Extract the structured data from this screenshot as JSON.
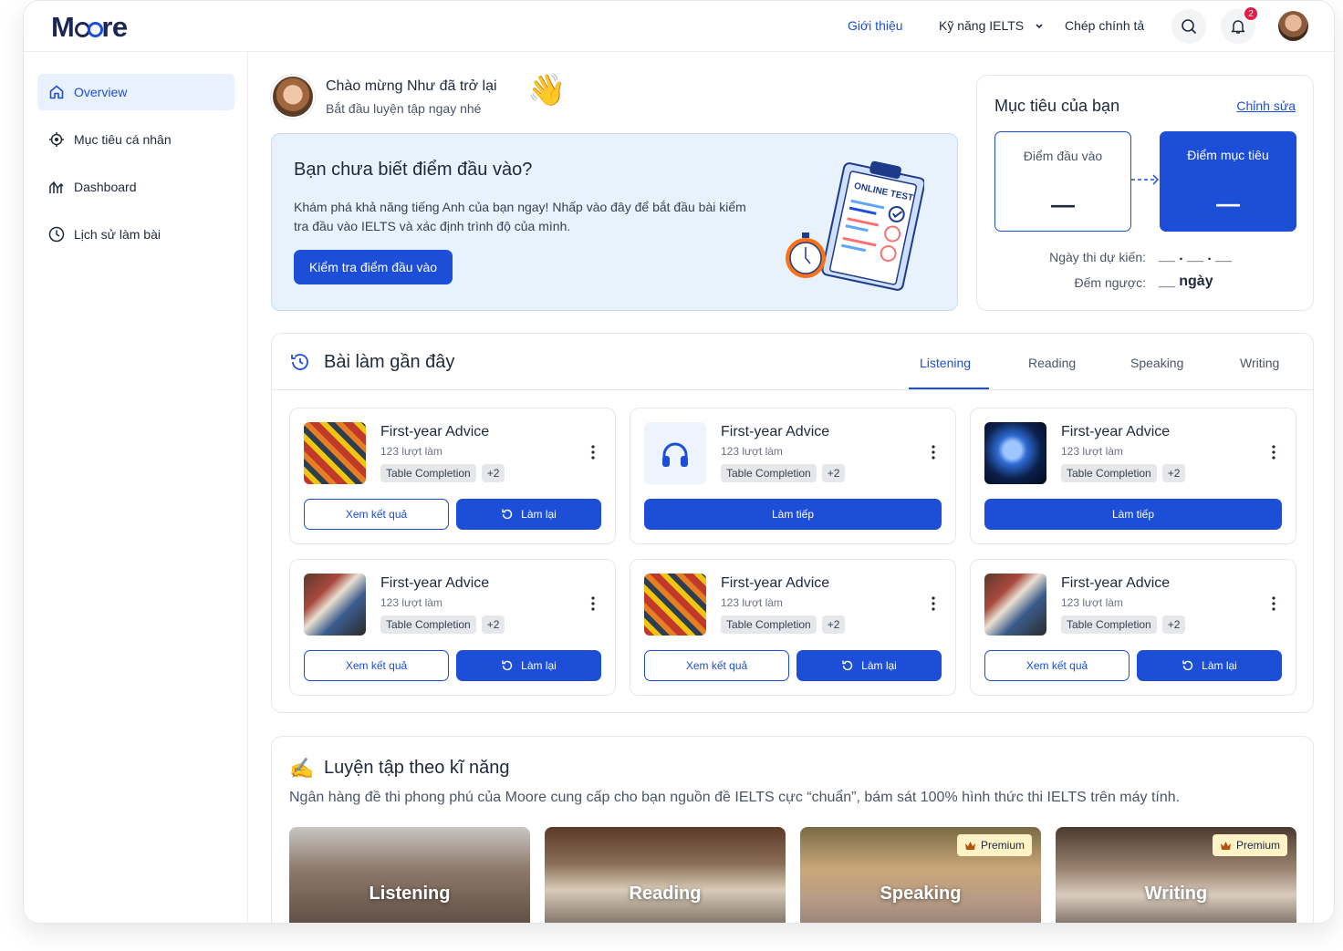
{
  "topbar": {
    "logo": "Moore",
    "nav": [
      "Giới thiệu",
      "Kỹ năng IELTS",
      "Chép chính tả"
    ],
    "notification_count": "2"
  },
  "sidebar": {
    "items": [
      {
        "label": "Overview",
        "icon": "home-icon",
        "active": true
      },
      {
        "label": "Mục tiêu cá nhân",
        "icon": "target-icon"
      },
      {
        "label": "Dashboard",
        "icon": "chart-icon"
      },
      {
        "label": "Lịch sử làm bài",
        "icon": "clock-icon"
      }
    ]
  },
  "welcome": {
    "title": "Chào mừng Như đã trở lại",
    "subtitle": "Bắt đầu luyện tập ngay nhé",
    "emoji": "👋"
  },
  "entry_test": {
    "title": "Bạn chưa biết điểm đầu vào?",
    "body": "Khám phá khả năng tiếng Anh của bạn ngay! Nhấp vào đây để bắt đầu bài kiểm tra đầu vào IELTS và xác định trình độ của mình.",
    "button": "Kiểm tra điểm đầu vào",
    "illustration_label": "ONLINE TEST"
  },
  "goal": {
    "title": "Mục tiêu của bạn",
    "edit": "Chỉnh sửa",
    "entry_label": "Điểm đầu vào",
    "entry_value": "—",
    "target_label": "Điểm mục tiêu",
    "target_value": "—",
    "exam_date_label": "Ngày thi dự kiến:",
    "exam_date_value": "__ . __ . __",
    "countdown_label": "Đếm ngược:",
    "countdown_value": "__ ngày"
  },
  "recent": {
    "title": "Bài làm gần đây",
    "tabs": [
      "Listening",
      "Reading",
      "Speaking",
      "Writing"
    ],
    "active_tab": "Listening",
    "cards": [
      {
        "title": "First-year Advice",
        "count": "123 lượt làm",
        "tag": "Table Completion",
        "more": "+2",
        "thumb": "comics",
        "btn1": "Xem kết quả",
        "btn2": "Làm lại"
      },
      {
        "title": "First-year Advice",
        "count": "123 lượt làm",
        "tag": "Table Completion",
        "more": "+2",
        "thumb": "headphones",
        "btn": "Làm tiếp"
      },
      {
        "title": "First-year Advice",
        "count": "123 lượt làm",
        "tag": "Table Completion",
        "more": "+2",
        "thumb": "globe",
        "btn": "Làm tiếp"
      },
      {
        "title": "First-year Advice",
        "count": "123 lượt làm",
        "tag": "Table Completion",
        "more": "+2",
        "thumb": "students",
        "btn1": "Xem kết quả",
        "btn2": "Làm lại"
      },
      {
        "title": "First-year Advice",
        "count": "123 lượt làm",
        "tag": "Table Completion",
        "more": "+2",
        "thumb": "comics",
        "btn1": "Xem kết quả",
        "btn2": "Làm lại"
      },
      {
        "title": "First-year Advice",
        "count": "123 lượt làm",
        "tag": "Table Completion",
        "more": "+2",
        "thumb": "students",
        "btn1": "Xem kết quả",
        "btn2": "Làm lại"
      }
    ]
  },
  "practice": {
    "title": "Luyện tập theo kĩ năng",
    "emoji": "✍️",
    "description": "Ngân hàng đề thi phong phú của Moore cung cấp cho bạn nguồn đề IELTS cực “chuẩn”, bám sát 100% hình thức thi IELTS trên máy tính.",
    "skills": [
      {
        "name": "Listening",
        "premium": ""
      },
      {
        "name": "Reading",
        "premium": ""
      },
      {
        "name": "Speaking",
        "premium": "Premium"
      },
      {
        "name": "Writing",
        "premium": "Premium"
      }
    ]
  },
  "colors": {
    "primary": "#1d4ed8",
    "light_blue": "#e8f2fd",
    "badge": "#e11d48",
    "premium_bg": "#fef3c7"
  }
}
